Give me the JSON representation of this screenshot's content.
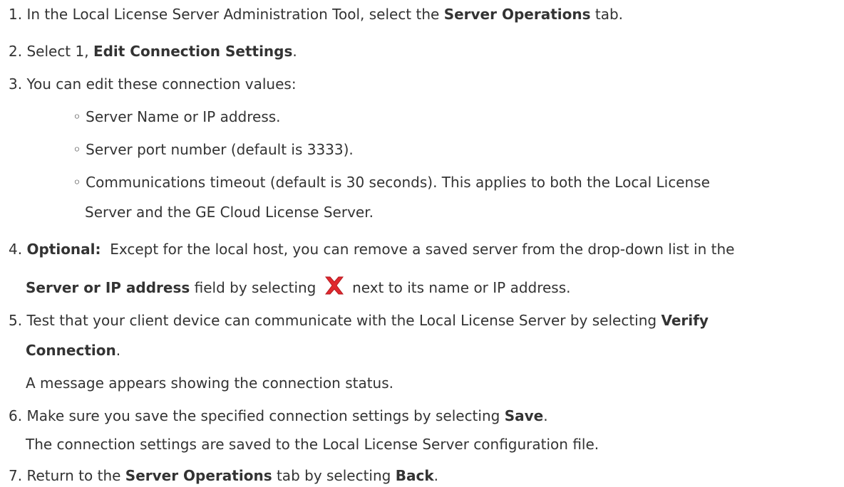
{
  "steps": [
    {
      "num": "1.",
      "pre": "In the Local License Server Administration Tool, select the ",
      "bold": "Server Operations",
      "post": " tab."
    },
    {
      "num": "2.",
      "pre": "Select 1, ",
      "bold": "Edit Connection Settings",
      "post": "."
    },
    {
      "num": "3.",
      "text": "You can edit these connection values:",
      "bullets": [
        {
          "marker": "◦",
          "text": "Server Name or IP address."
        },
        {
          "marker": "◦",
          "text": "Server port number (default is 3333)."
        },
        {
          "marker": "◦",
          "text": "Communications timeout (default is 30 seconds). This applies to both the Local License",
          "cont": "Server and the GE Cloud License Server."
        }
      ]
    },
    {
      "num": "4.",
      "bold": "Optional:",
      "text": "  Except for the local host, you can remove a saved server from the drop-down list in the",
      "line2_bold": "Server or IP address",
      "line2_pre": " field by selecting ",
      "icon": "red-x-remove-icon",
      "line2_post": " next to its name or IP address."
    },
    {
      "num": "5.",
      "text": "Test that your client device can communicate with the Local License Server by selecting ",
      "bold": "Verify",
      "line2_bold": "Connection",
      "line2_post": ".",
      "note": "A message appears showing the connection status."
    },
    {
      "num": "6.",
      "pre": "Make sure you save the specified connection settings by selecting ",
      "bold": "Save",
      "post": ".",
      "note": "The connection settings are saved to the Local License Server configuration file."
    },
    {
      "num": "7.",
      "pre": "Return to the ",
      "bold": "Server Operations",
      "mid": " tab by selecting ",
      "bold2": "Back",
      "post": "."
    }
  ],
  "colors": {
    "text": "#333333",
    "icon_red": "#e0282e"
  }
}
